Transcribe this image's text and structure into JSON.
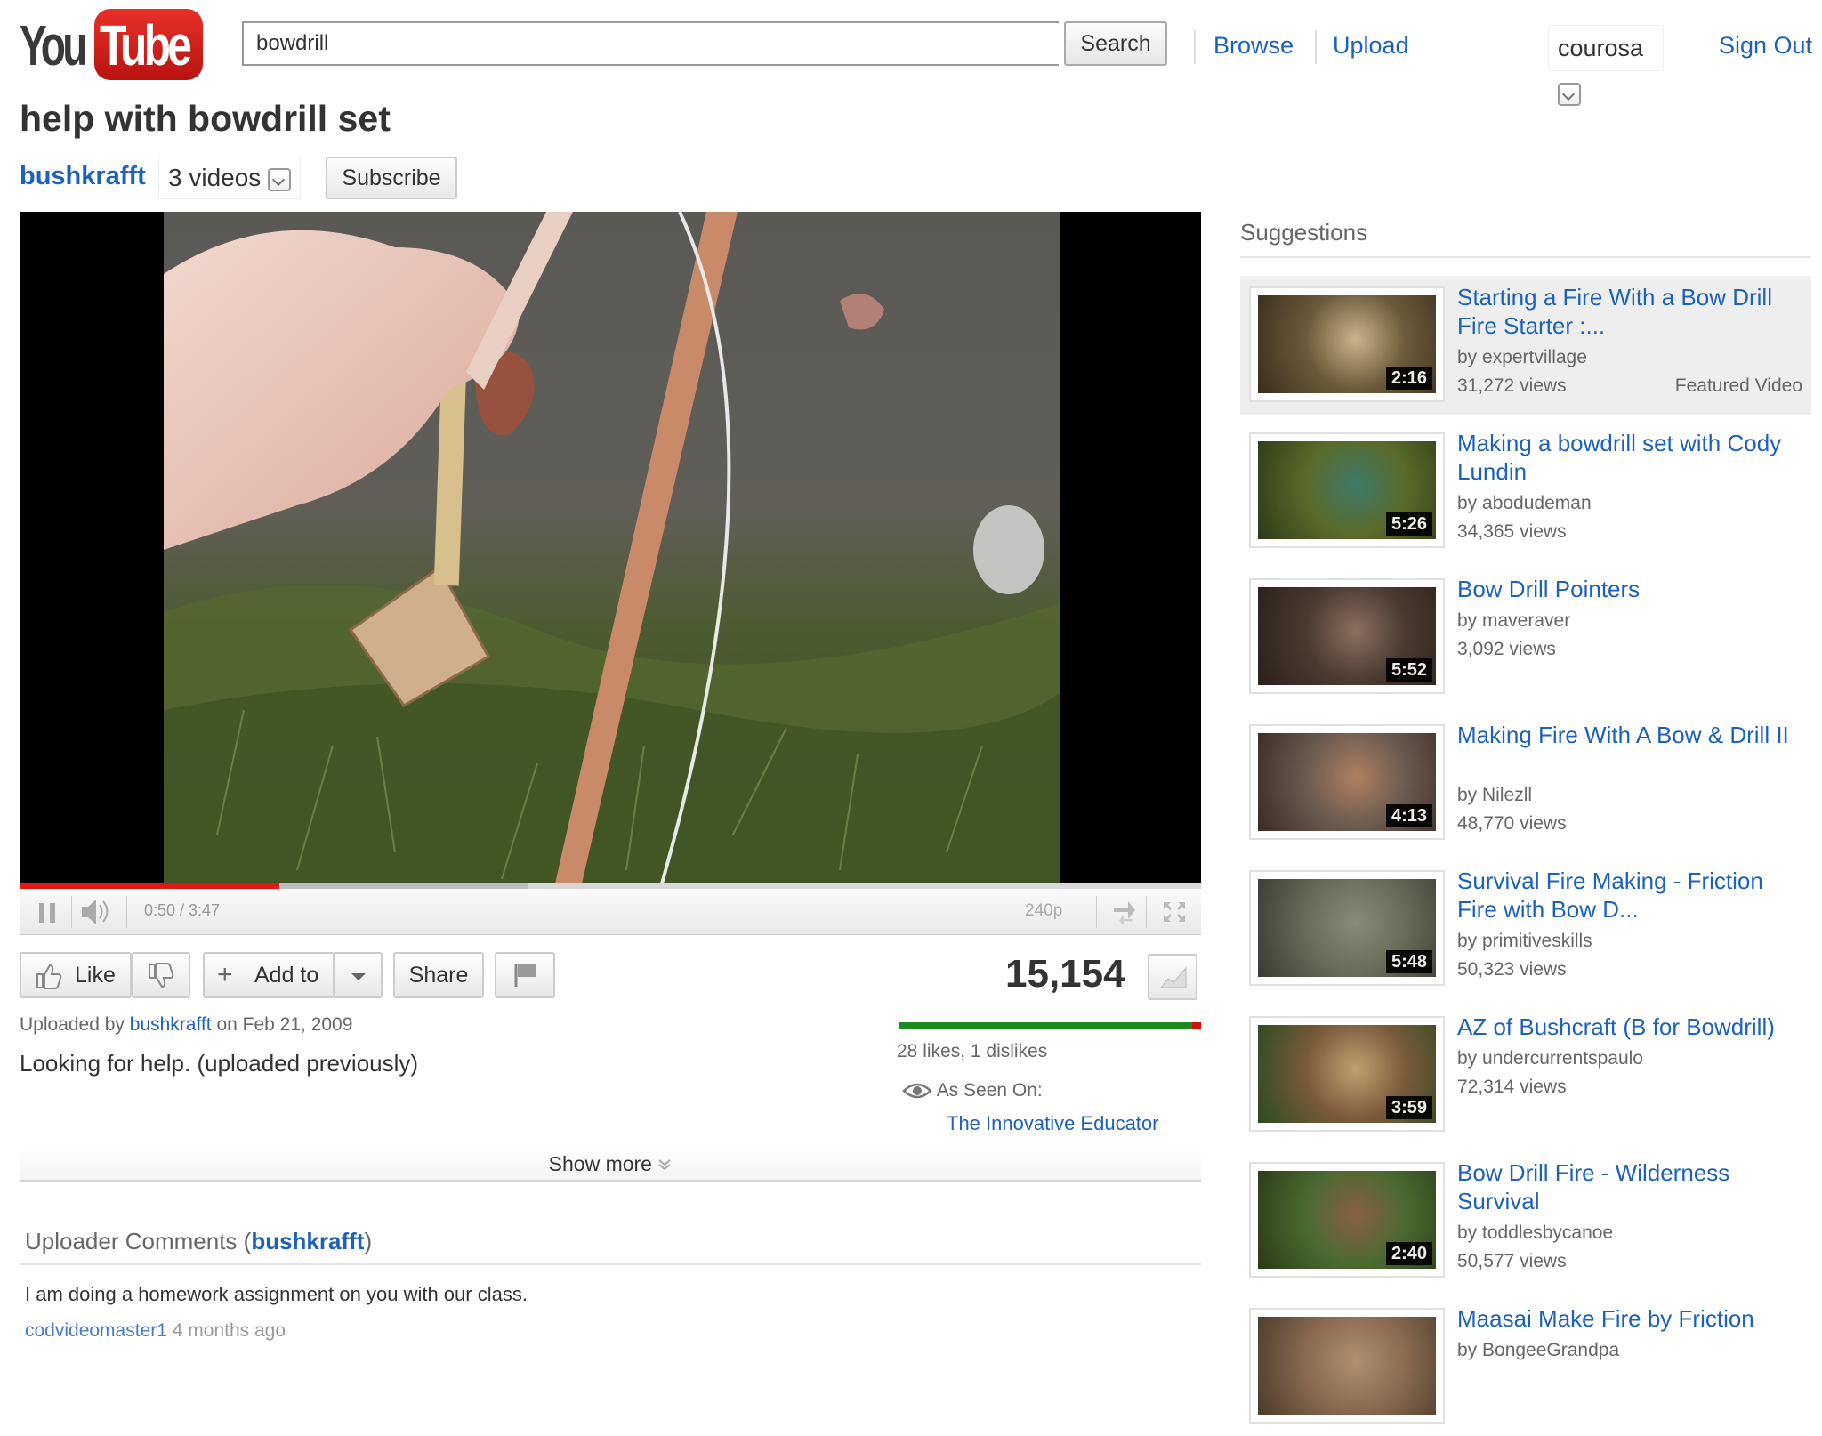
{
  "header": {
    "logo_you": "You",
    "logo_tube": "Tube",
    "search_value": "bowdrill",
    "search_button": "Search",
    "browse": "Browse",
    "upload": "Upload",
    "username": "courosa",
    "sign_out": "Sign Out"
  },
  "video": {
    "title": "help with bowdrill set",
    "channel": "bushkrafft",
    "videos_count": "3 videos",
    "subscribe": "Subscribe",
    "time": "0:50 / 3:47",
    "quality": "240p",
    "progress": 0.22,
    "buffered": 0.43
  },
  "actions": {
    "like": "Like",
    "add_to": "Add to",
    "share": "Share",
    "view_count": "15,154"
  },
  "info": {
    "uploaded_prefix": "Uploaded by",
    "uploader": "bushkrafft",
    "uploaded_suffix": "on Feb 21, 2009",
    "description": "Looking for help. (uploaded previously)",
    "likes": "28 likes, 1 dislikes",
    "like_ratio": 0.97,
    "as_seen_on": "As Seen On:",
    "seen_on_source": "The Innovative Educator",
    "show_more": "Show more"
  },
  "comments": {
    "heading_prefix": "Uploader Comments (",
    "heading_user": "bushkrafft",
    "heading_suffix": ")",
    "items": [
      {
        "text": "I am doing a homework assignment on you with our class.",
        "author": "codvideomaster1",
        "age": "4 months ago"
      }
    ]
  },
  "sidebar": {
    "heading": "Suggestions",
    "featured_label": "Featured Video",
    "items": [
      {
        "title": "Starting a Fire With a Bow Drill Fire Starter :...",
        "by": "by expertvillage",
        "views": "31,272 views",
        "duration": "2:16",
        "colors": [
          "#6b5a3a",
          "#c9b48a",
          "#3a2e1c"
        ]
      },
      {
        "title": "Making a bowdrill set with Cody Lundin",
        "by": "by abodudeman",
        "views": "34,365 views",
        "duration": "5:26",
        "colors": [
          "#5b6a2a",
          "#3f7a6a",
          "#2c3a18"
        ]
      },
      {
        "title": "Bow Drill Pointers",
        "by": "by maveraver",
        "views": "3,092 views",
        "duration": "5:52",
        "colors": [
          "#4a3a30",
          "#8a7060",
          "#2a201a"
        ]
      },
      {
        "title": "Making Fire With A Bow & Drill II",
        "by": "by Nilezll",
        "views": "48,770 views",
        "duration": "4:13",
        "colors": [
          "#6a5a50",
          "#b08060",
          "#3a2a22"
        ]
      },
      {
        "title": "Survival Fire Making - Friction Fire with Bow D...",
        "by": "by primitiveskills",
        "views": "50,323 views",
        "duration": "5:48",
        "colors": [
          "#6a6a5a",
          "#8a8a78",
          "#3a3a30"
        ]
      },
      {
        "title": "AZ of Bushcraft (B for Bowdrill)",
        "by": "by undercurrentspaulo",
        "views": "72,314 views",
        "duration": "3:59",
        "colors": [
          "#7a5a3a",
          "#c0a070",
          "#2a4a20"
        ]
      },
      {
        "title": "Bow Drill Fire - Wilderness Survival",
        "by": "by toddlesbycanoe",
        "views": "50,577 views",
        "duration": "2:40",
        "colors": [
          "#4a6a30",
          "#8a6040",
          "#2a3a18"
        ]
      },
      {
        "title": "Maasai Make Fire by Friction",
        "by": "by BongeeGrandpa",
        "views": "",
        "duration": "",
        "colors": [
          "#8a6a50",
          "#b09070",
          "#4a3a2a"
        ]
      }
    ]
  }
}
